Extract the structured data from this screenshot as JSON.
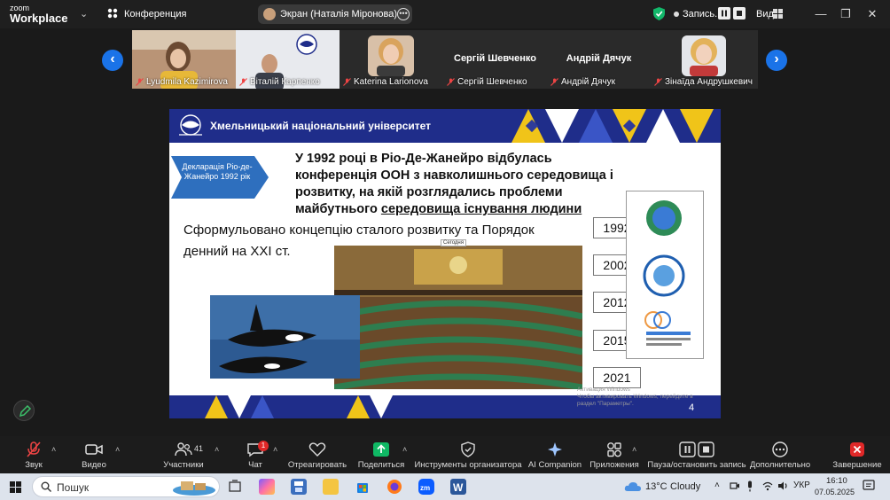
{
  "topbar": {
    "logo_line1": "zoom",
    "logo_line2": "Workplace",
    "meeting_title": "Конференция",
    "share_label": "Экран (Наталія Міронова)",
    "recording_label": "Запись...",
    "view_label": "Вид"
  },
  "gallery": {
    "participants": [
      {
        "name": "Lyudmila Kazimirova",
        "big_name": ""
      },
      {
        "name": "Віталій Карпенко",
        "big_name": ""
      },
      {
        "name": "Katerina Larionova",
        "big_name": ""
      },
      {
        "name": "Сергій Шевченко",
        "big_name": "Сергій Шевченко"
      },
      {
        "name": "Андрій Дячук",
        "big_name": "Андрій Дячук"
      },
      {
        "name": "Зінаїда Андрушкевич",
        "big_name": ""
      }
    ]
  },
  "slide": {
    "header_title": "Хмельницький національний університет",
    "declaration": "Декларація Ріо-де-Жанейро 1992 рік",
    "main_text_1": "У 1992 році в Ріо-Де-Жанейро відбулась конференція ООН з навколишнього середовища і розвитку, на якій розглядались проблеми майбутнього ",
    "main_text_underlined": "середовища існування людини",
    "concept_text": "Сформульовано концепцію сталого розвитку та Порядок денний на XXI ст.",
    "tooltip": "Сегодня",
    "years": [
      "1992",
      "2002",
      "2012",
      "2015",
      "2021"
    ],
    "activation_line1": "Активация Windows",
    "activation_line2": "Чтобы активировать Windows, перейдите в раздел \"Параметры\".",
    "slide_number": "4"
  },
  "toolbar": {
    "sound": "Звук",
    "video": "Видео",
    "participants": "Участники",
    "participants_count": "41",
    "chat": "Чат",
    "chat_badge": "1",
    "react": "Отреагировать",
    "share": "Поделиться",
    "host_tools": "Инструменты организатора",
    "companion": "AI Companion",
    "apps": "Приложения",
    "pause_rec": "Пауза/остановить запись",
    "more": "Дополнительно",
    "end": "Завершение"
  },
  "taskbar": {
    "search_label": "Пошук",
    "weather_temp": "13°C",
    "weather_desc": "Cloudy",
    "lang": "УКР",
    "time": "16:10",
    "date": "07.05.2025"
  },
  "colors": {
    "zoom_blue": "#1a73e8",
    "slide_navy": "#1f2d8a",
    "end_red": "#e02828",
    "share_green": "#0fb864"
  }
}
